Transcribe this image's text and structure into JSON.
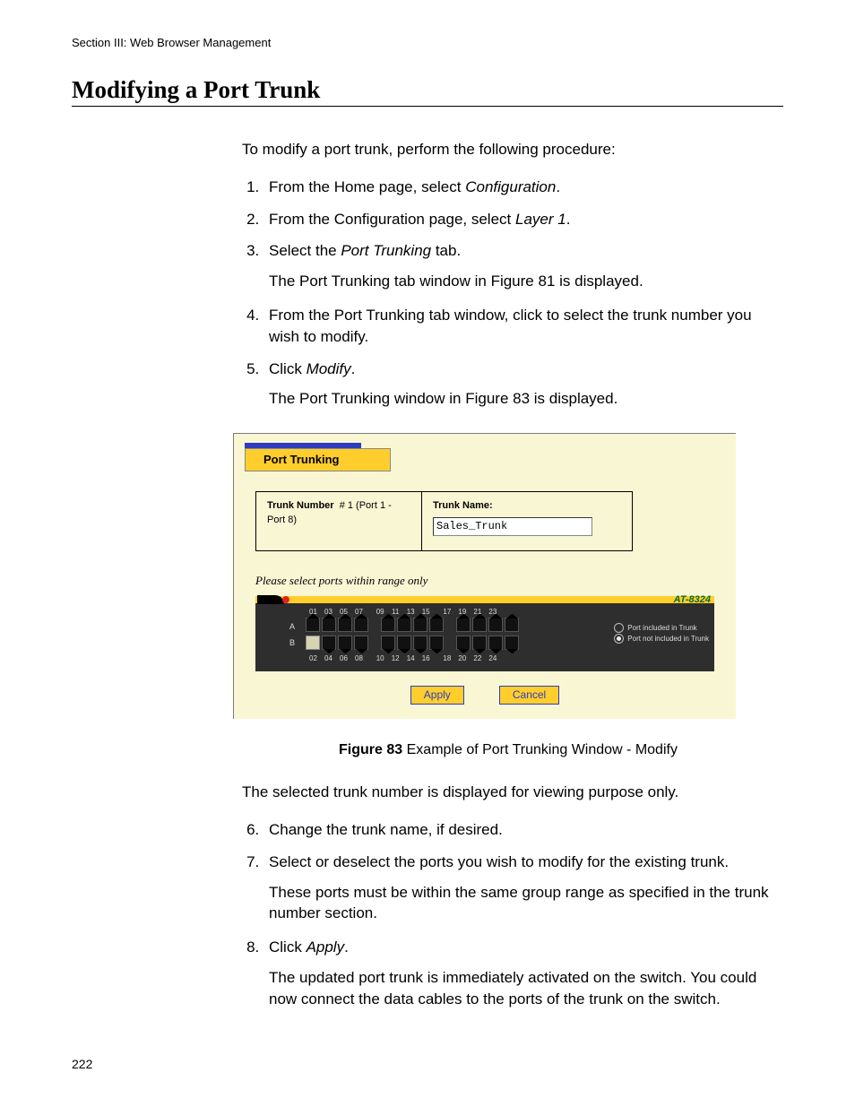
{
  "header": "Section III:  Web Browser Management",
  "title": "Modifying a Port Trunk",
  "intro": "To modify a port trunk, perform the following procedure:",
  "steps": {
    "s1a": "From the Home page, select ",
    "s1b": "Configuration",
    "s1c": ".",
    "s2a": "From the Configuration page, select ",
    "s2b": "Layer 1",
    "s2c": ".",
    "s3a": "Select the ",
    "s3b": "Port Trunking",
    "s3c": " tab.",
    "s3p": "The Port Trunking tab window in Figure 81 is displayed.",
    "s4": "From the Port Trunking tab window, click to select the trunk number you wish to modify.",
    "s5a": "Click ",
    "s5b": "Modify",
    "s5c": ".",
    "s5p": "The Port Trunking window in Figure 83 is displayed.",
    "s6": "Change the trunk name, if desired.",
    "s7": "Select or deselect the ports you wish to modify for the existing trunk.",
    "s7p": "These ports must be within the same group range as specified in the trunk number section.",
    "s8a": "Click ",
    "s8b": "Apply",
    "s8c": ".",
    "s8p": "The updated port trunk is immediately activated on the switch. You could now connect the data cables to the ports of the trunk on the switch."
  },
  "afterFigure": "The selected trunk number is displayed for viewing purpose only.",
  "figure": {
    "captionBold": "Figure 83",
    "captionRest": "  Example of Port Trunking Window - Modify",
    "tabLabel": "Port Trunking",
    "trunkNumberLabel": "Trunk Number",
    "trunkNumberValue": "# 1 (Port 1 - Port 8)",
    "trunkNameLabel": "Trunk Name:",
    "trunkNameValue": "Sales_Trunk",
    "selectNote": "Please select ports within range only",
    "model": "AT-8324",
    "legendIncluded": "Port included in Trunk",
    "legendNotIncluded": "Port not included in Trunk",
    "applyLabel": "Apply",
    "cancelLabel": "Cancel",
    "topPorts": [
      "01",
      "03",
      "05",
      "07",
      "09",
      "11",
      "13",
      "15",
      "17",
      "19",
      "21",
      "23"
    ],
    "botPorts": [
      "02",
      "04",
      "06",
      "08",
      "10",
      "12",
      "14",
      "16",
      "18",
      "20",
      "22",
      "24"
    ]
  },
  "pageNumber": "222"
}
